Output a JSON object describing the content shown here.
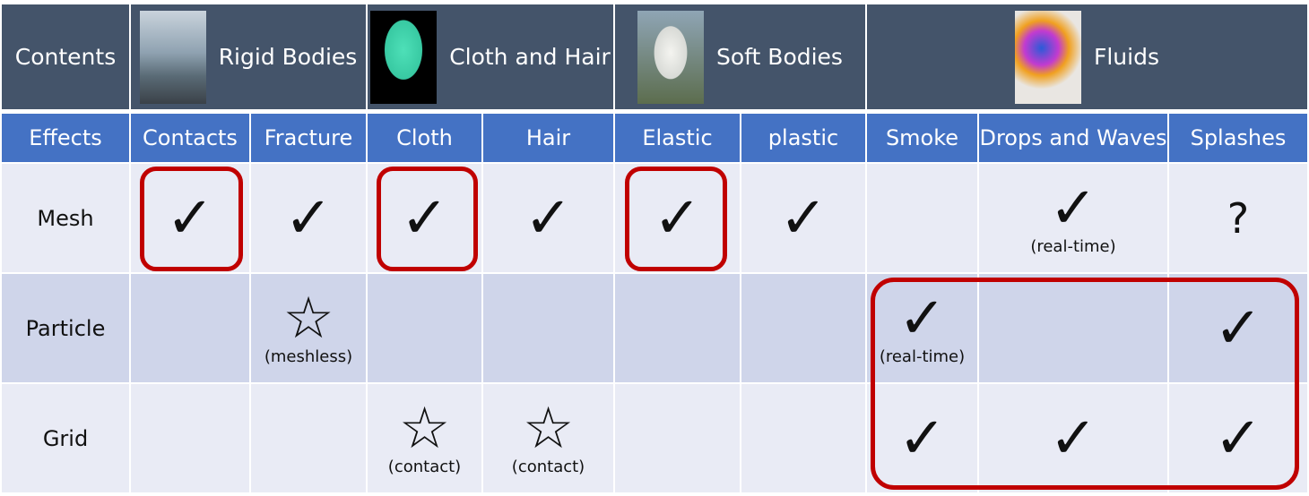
{
  "header": {
    "corner": "Contents",
    "groups": [
      {
        "label": "Rigid Bodies",
        "image": "stacked-stones-photo"
      },
      {
        "label": "Cloth and Hair",
        "image": "jacket-photo"
      },
      {
        "label": "Soft Bodies",
        "image": "michelin-man-photo"
      },
      {
        "label": "Fluids",
        "image": "paint-splash-photo"
      }
    ]
  },
  "effects": {
    "corner": "Effects",
    "items": [
      "Contacts",
      "Fracture",
      "Cloth",
      "Hair",
      "Elastic",
      "plastic",
      "Smoke",
      "Drops and Waves",
      "Splashes"
    ]
  },
  "rows": [
    {
      "label": "Mesh",
      "cells": [
        {
          "mark": "✓"
        },
        {
          "mark": "✓"
        },
        {
          "mark": "✓"
        },
        {
          "mark": "✓"
        },
        {
          "mark": "✓"
        },
        {
          "mark": "✓"
        },
        {
          "mark": ""
        },
        {
          "mark": "✓",
          "note": "(real-time)"
        },
        {
          "mark": "?"
        }
      ]
    },
    {
      "label": "Particle",
      "cells": [
        {
          "mark": ""
        },
        {
          "mark": "☆",
          "note": "(meshless)"
        },
        {
          "mark": ""
        },
        {
          "mark": ""
        },
        {
          "mark": ""
        },
        {
          "mark": ""
        },
        {
          "mark": "✓",
          "note": "(real-time)"
        },
        {
          "mark": ""
        },
        {
          "mark": "✓"
        }
      ]
    },
    {
      "label": "Grid",
      "cells": [
        {
          "mark": ""
        },
        {
          "mark": ""
        },
        {
          "mark": "☆",
          "note": "(contact)"
        },
        {
          "mark": "☆",
          "note": "(contact)"
        },
        {
          "mark": ""
        },
        {
          "mark": ""
        },
        {
          "mark": "✓"
        },
        {
          "mark": "✓"
        },
        {
          "mark": "✓"
        }
      ]
    }
  ],
  "colors": {
    "header": "#44546a",
    "effects": "#4472c4",
    "row_light": "#e9ebf5",
    "row_dark": "#cfd5ea",
    "highlight": "#c00000"
  }
}
